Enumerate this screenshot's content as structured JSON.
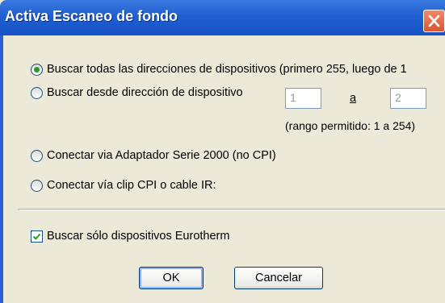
{
  "window": {
    "title": "Activa Escaneo de fondo"
  },
  "options": {
    "scan_all": "Buscar todas las direcciones de dispositivos (primero 255, luego de 1",
    "scan_range": "Buscar desde dirección de dispositivo",
    "range_from": "1",
    "range_to_label": "a",
    "range_to": "2",
    "range_hint": "(rango permitido: 1 a 254)",
    "serial_adapter": "Conectar via Adaptador Serie 2000 (no CPI)",
    "cpi_clip": "Conectar vía clip CPI o cable IR:"
  },
  "filter": {
    "eurotherm_only": "Buscar sólo dispositivos Eurotherm"
  },
  "buttons": {
    "ok": "OK",
    "cancel": "Cancelar"
  },
  "colors": {
    "titlebar": "#1f5fd1",
    "dialog_bg": "#ece9d8",
    "close_button": "#d8562e",
    "radio_dot": "#2c9a2c"
  }
}
